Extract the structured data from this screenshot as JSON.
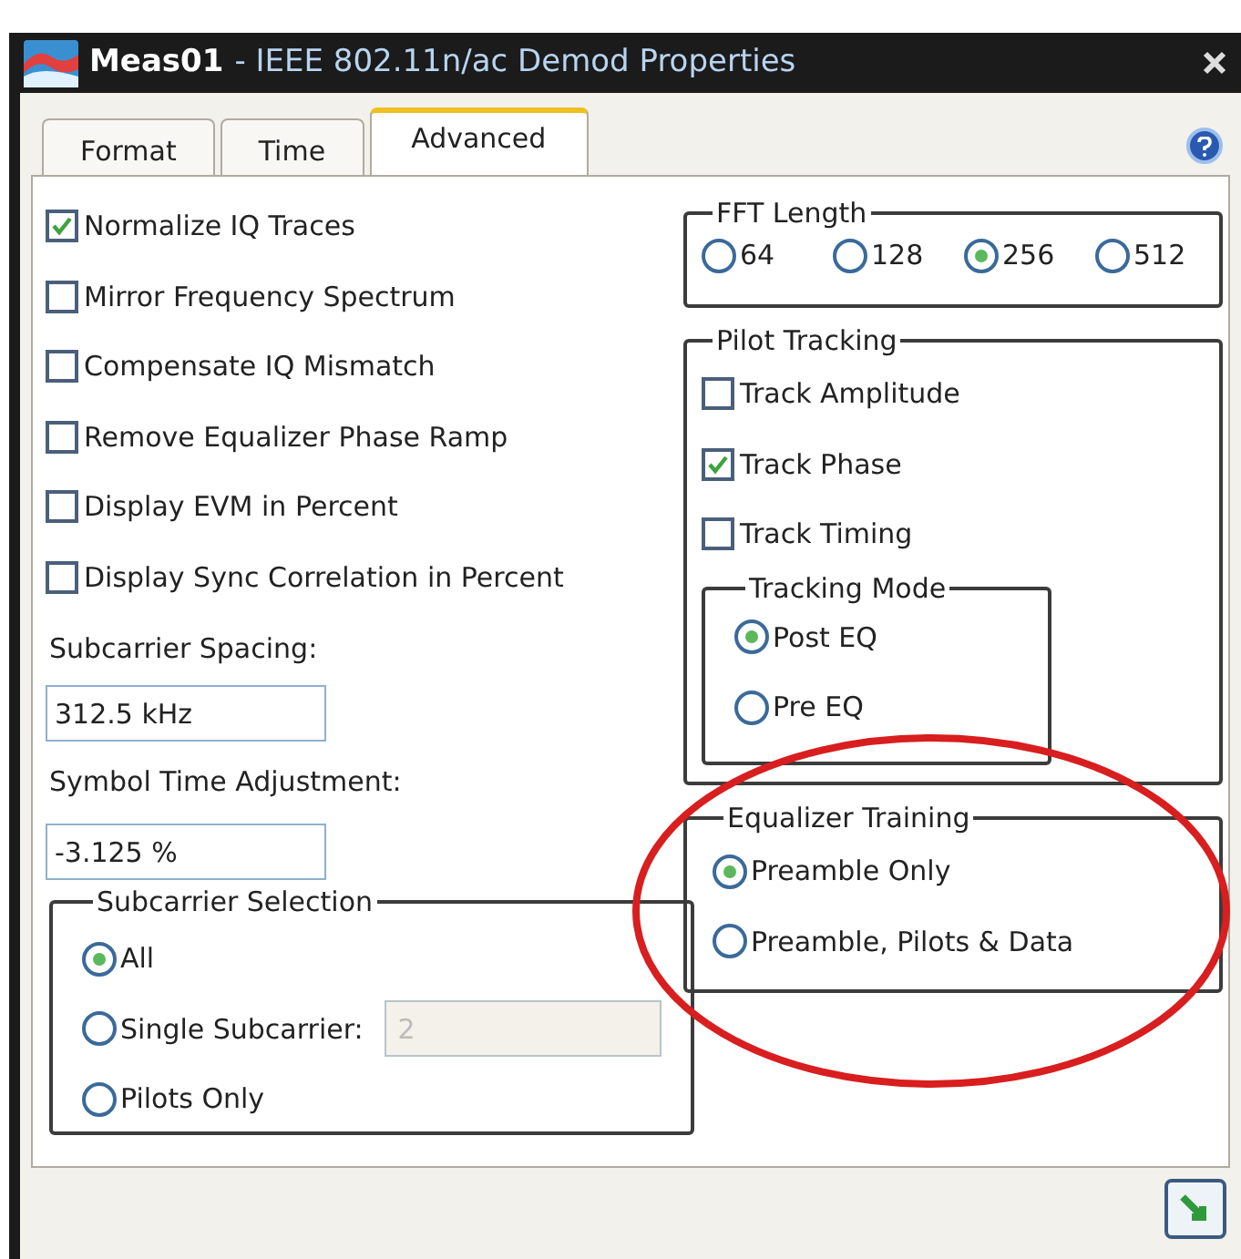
{
  "window": {
    "title_name": "Meas01",
    "title_rest": "- IEEE 802.11n/ac Demod Properties"
  },
  "tabs": [
    {
      "label": "Format",
      "selected": false
    },
    {
      "label": "Time",
      "selected": false
    },
    {
      "label": "Advanced",
      "selected": true
    }
  ],
  "options": [
    {
      "label": "Normalize IQ Traces",
      "checked": true
    },
    {
      "label": "Mirror Frequency Spectrum",
      "checked": false
    },
    {
      "label": "Compensate IQ Mismatch",
      "checked": false
    },
    {
      "label": "Remove Equalizer Phase Ramp",
      "checked": false
    },
    {
      "label": "Display EVM in Percent",
      "checked": false
    },
    {
      "label": "Display Sync Correlation in Percent",
      "checked": false
    }
  ],
  "subcarrier_spacing": {
    "label": "Subcarrier Spacing:",
    "value": "312.5 kHz"
  },
  "symbol_time_adjustment": {
    "label": "Symbol Time Adjustment:",
    "value": "-3.125 %"
  },
  "subcarrier_selection": {
    "title": "Subcarrier Selection",
    "choices": [
      {
        "label": "All",
        "selected": true
      },
      {
        "label": "Single Subcarrier:",
        "selected": false,
        "field": {
          "value": "2",
          "disabled": true
        }
      },
      {
        "label": "Pilots Only",
        "selected": false
      }
    ]
  },
  "fft_length": {
    "title": "FFT Length",
    "choices": [
      {
        "label": "64",
        "selected": false
      },
      {
        "label": "128",
        "selected": false
      },
      {
        "label": "256",
        "selected": true
      },
      {
        "label": "512",
        "selected": false
      }
    ]
  },
  "pilot_tracking": {
    "title": "Pilot Tracking",
    "options": [
      {
        "label": "Track Amplitude",
        "checked": false
      },
      {
        "label": "Track Phase",
        "checked": true
      },
      {
        "label": "Track Timing",
        "checked": false
      }
    ],
    "tracking_mode": {
      "title": "Tracking Mode",
      "choices": [
        {
          "label": "Post EQ",
          "selected": true
        },
        {
          "label": "Pre EQ",
          "selected": false
        }
      ]
    }
  },
  "equalizer_training": {
    "title": "Equalizer Training",
    "choices": [
      {
        "label": "Preamble Only",
        "selected": true
      },
      {
        "label": "Preamble, Pilots & Data",
        "selected": false
      }
    ]
  }
}
